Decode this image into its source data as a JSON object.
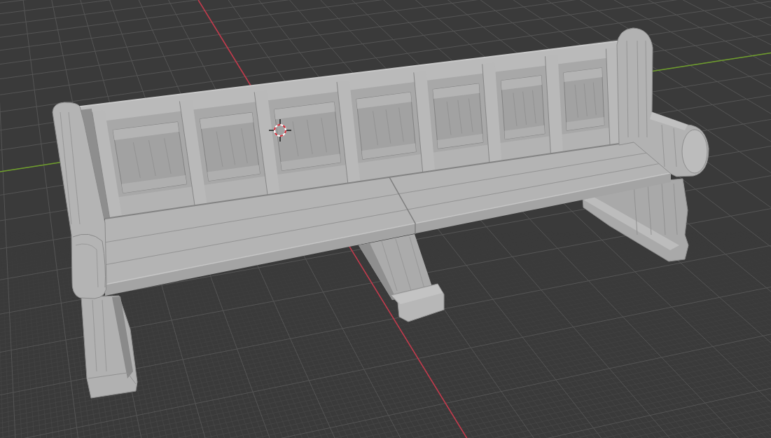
{
  "viewport": {
    "axes": [
      {
        "kind": "x",
        "color": "#c23a4c"
      },
      {
        "kind": "y",
        "color": "#6f9e2c"
      }
    ],
    "objects": [
      {
        "kind": "bench"
      }
    ]
  }
}
